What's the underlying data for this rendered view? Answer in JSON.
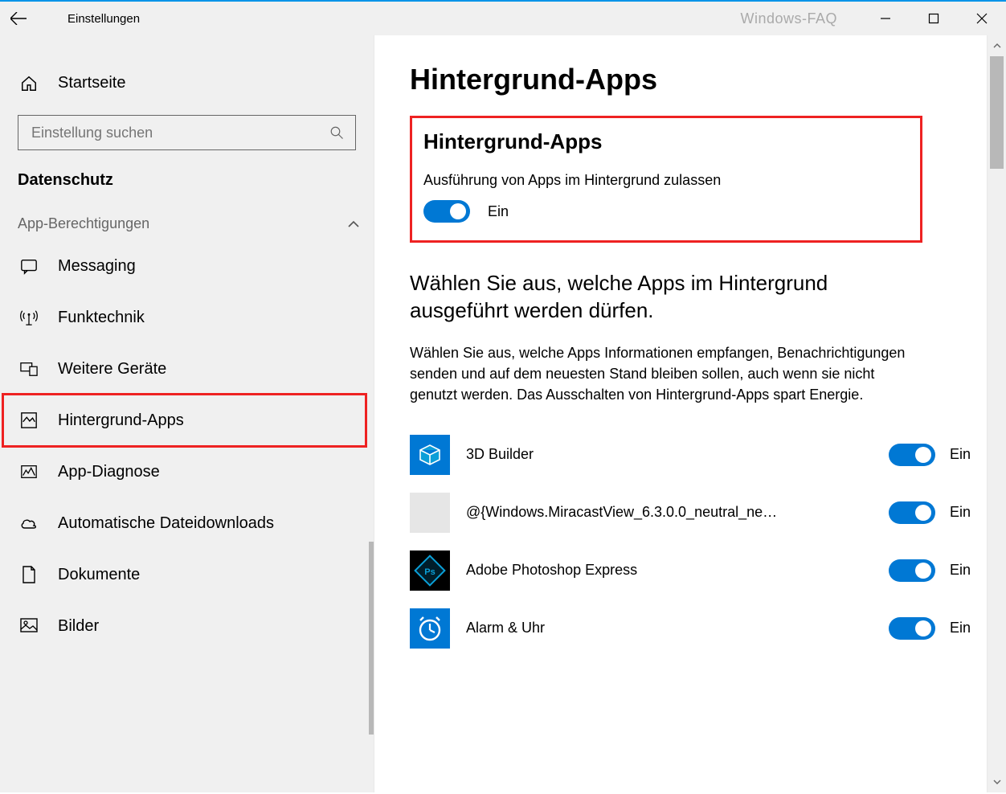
{
  "window": {
    "title": "Einstellungen",
    "watermark": "Windows-FAQ"
  },
  "sidebar": {
    "home_label": "Startseite",
    "search_placeholder": "Einstellung suchen",
    "category_label": "Datenschutz",
    "section_label": "App-Berechtigungen",
    "items": [
      {
        "icon": "messaging",
        "label": "Messaging",
        "selected": false
      },
      {
        "icon": "radio",
        "label": "Funktechnik",
        "selected": false
      },
      {
        "icon": "devices",
        "label": "Weitere Geräte",
        "selected": false
      },
      {
        "icon": "background",
        "label": "Hintergrund-Apps",
        "selected": true
      },
      {
        "icon": "diagnose",
        "label": "App-Diagnose",
        "selected": false
      },
      {
        "icon": "cloud",
        "label": "Automatische Dateidownloads",
        "selected": false
      },
      {
        "icon": "document",
        "label": "Dokumente",
        "selected": false
      },
      {
        "icon": "images",
        "label": "Bilder",
        "selected": false
      }
    ]
  },
  "main": {
    "page_title": "Hintergrund-Apps",
    "section_title": "Hintergrund-Apps",
    "allow_label": "Ausführung von Apps im Hintergrund zulassen",
    "master_toggle": {
      "on": true,
      "state_text": "Ein"
    },
    "choose_title": "Wählen Sie aus, welche Apps im Hintergrund ausgeführt werden dürfen.",
    "choose_desc": "Wählen Sie aus, welche Apps Informationen empfangen, Benachrichtigungen senden und auf dem neuesten Stand bleiben sollen, auch wenn sie nicht genutzt werden. Das Ausschalten von Hintergrund-Apps spart Energie.",
    "apps": [
      {
        "name": "3D Builder",
        "icon_bg": "#0078d4",
        "icon_glyph": "3d",
        "state_text": "Ein"
      },
      {
        "name": "@{Windows.MiracastView_6.3.0.0_neutral_ne…",
        "icon_bg": "#e6e6e6",
        "icon_glyph": "blank",
        "state_text": "Ein"
      },
      {
        "name": "Adobe Photoshop Express",
        "icon_bg": "#000000",
        "icon_glyph": "ps",
        "state_text": "Ein"
      },
      {
        "name": "Alarm & Uhr",
        "icon_bg": "#0078d4",
        "icon_glyph": "clock",
        "state_text": "Ein"
      }
    ]
  }
}
